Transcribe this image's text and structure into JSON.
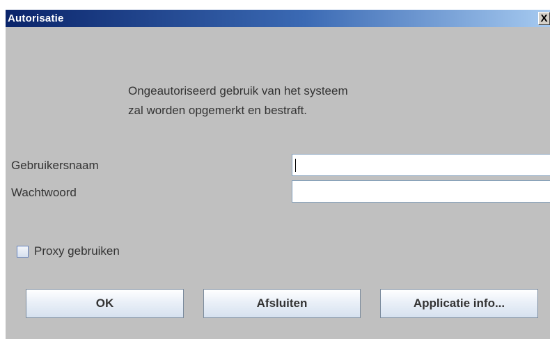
{
  "window": {
    "title": "Autorisatie",
    "close_symbol": "X"
  },
  "notice": {
    "line1": "Ongeautoriseerd gebruik van het systeem",
    "line2": "zal worden opgemerkt en bestraft."
  },
  "form": {
    "username_label": "Gebruikersnaam",
    "username_value": "",
    "password_label": "Wachtwoord",
    "password_value": "",
    "proxy_label": "Proxy gebruiken",
    "proxy_checked": false
  },
  "buttons": {
    "ok": "OK",
    "close": "Afsluiten",
    "info": "Applicatie info..."
  }
}
